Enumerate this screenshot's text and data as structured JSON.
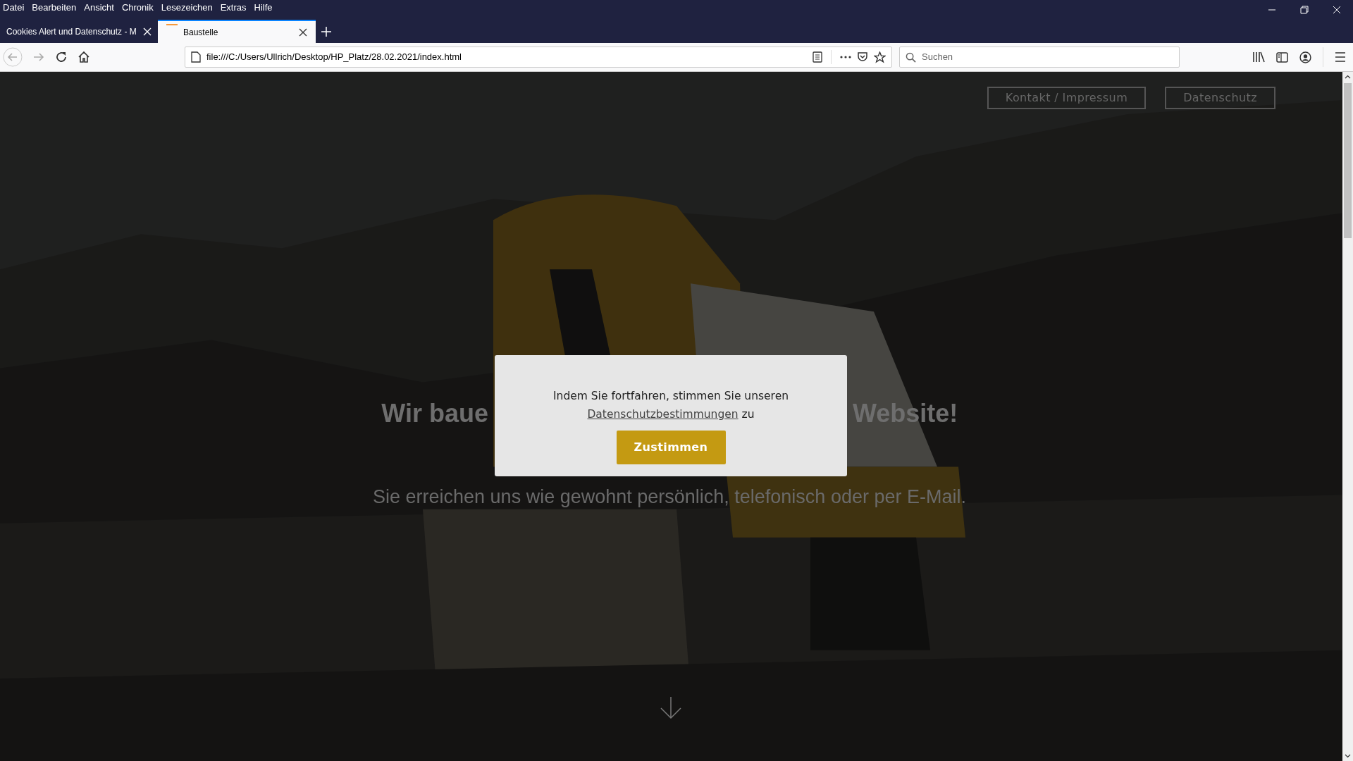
{
  "menu_bar": [
    "Datei",
    "Bearbeiten",
    "Ansicht",
    "Chronik",
    "Lesezeichen",
    "Extras",
    "Hilfe"
  ],
  "tabs": [
    {
      "title": "Cookies Alert und Datenschutz - M",
      "selected": false
    },
    {
      "title": "Baustelle",
      "selected": true
    }
  ],
  "address_bar": {
    "value": "file:///C:/Users/Ullrich/Desktop/HP_Platz/28.02.2021/index.html"
  },
  "search": {
    "placeholder": "Suchen"
  },
  "page": {
    "nav": [
      "Kontakt / Impressum",
      "Datenschutz"
    ],
    "heading_parts": [
      "Wir baue",
      "Website!"
    ],
    "subtitle": "Sie erreichen uns wie gewohnt persönlich, telefonisch oder per E-Mail."
  },
  "consent_dialog": {
    "text_before": "Indem Sie fortfahren, stimmen Sie unseren",
    "link": "Datenschutzbestimmungen",
    "text_after": "zu",
    "button": "Zustimmen"
  }
}
